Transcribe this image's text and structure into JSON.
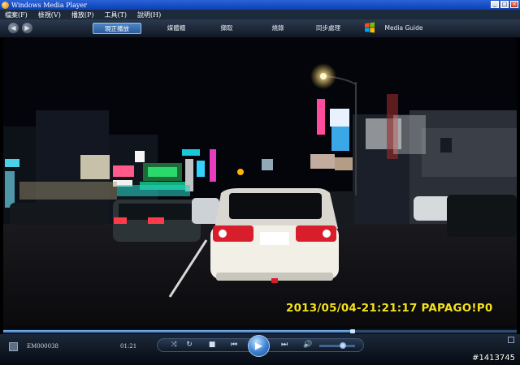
{
  "window": {
    "title": "Windows Media Player",
    "controls": [
      "_",
      "□",
      "×"
    ]
  },
  "menu": [
    "檔案(F)",
    "檢視(V)",
    "播放(P)",
    "工具(T)",
    "說明(H)"
  ],
  "nav": {
    "tabs": [
      {
        "label": "現正播放",
        "active": true
      },
      {
        "label": "媒體櫃",
        "active": false
      },
      {
        "label": "擷取",
        "active": false
      },
      {
        "label": "燒錄",
        "active": false
      },
      {
        "label": "同步處理",
        "active": false
      },
      {
        "label": "Media Guide",
        "active": false
      }
    ]
  },
  "video": {
    "overlay_timestamp": "2013/05/04-21:21:17 PAPAGO!P0"
  },
  "player": {
    "filename": "EM000038",
    "elapsed": "01:21",
    "progress": 0.68,
    "volume": 0.6
  },
  "watermark": "#1413745",
  "colors": {
    "title_bar": "#0b40b4",
    "overlay_text": "#f3e21c",
    "accent": "#3a7fd0"
  }
}
